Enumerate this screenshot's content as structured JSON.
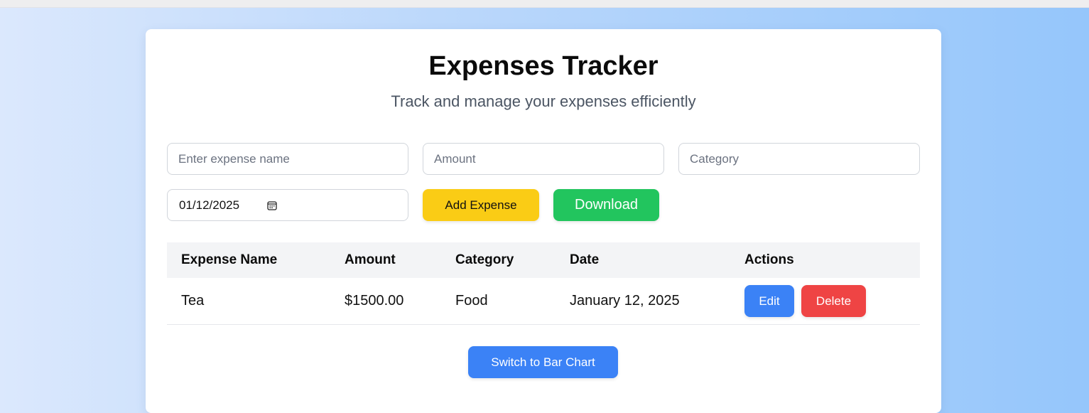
{
  "header": {
    "title": "Expenses Tracker",
    "subtitle": "Track and manage your expenses efficiently"
  },
  "form": {
    "name_placeholder": "Enter expense name",
    "amount_placeholder": "Amount",
    "category_placeholder": "Category",
    "date_value": "01/12/2025",
    "add_label": "Add Expense",
    "download_label": "Download"
  },
  "table": {
    "headers": [
      "Expense Name",
      "Amount",
      "Category",
      "Date",
      "Actions"
    ],
    "rows": [
      {
        "name": "Tea",
        "amount": "$1500.00",
        "category": "Food",
        "date": "January 12, 2025",
        "edit_label": "Edit",
        "delete_label": "Delete"
      }
    ]
  },
  "footer": {
    "switch_label": "Switch to Bar Chart"
  },
  "icons": {
    "date_picker": "calendar-icon"
  },
  "colors": {
    "add_button": "#facc15",
    "download_button": "#22c55e",
    "primary": "#3b82f6",
    "danger": "#ef4444"
  }
}
